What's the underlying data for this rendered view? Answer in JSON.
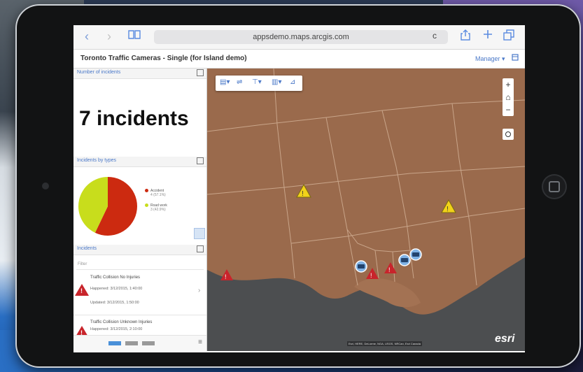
{
  "browser": {
    "url": "appsdemo.maps.arcgis.com",
    "back_glyph": "‹",
    "forward_glyph": "›",
    "reload_glyph": "c"
  },
  "app": {
    "title": "Toronto Traffic Cameras - Single (for Island demo)",
    "manager_label": "Manager ▾"
  },
  "panels": {
    "count": {
      "title": "Number of incidents",
      "value": "7 incidents"
    },
    "types": {
      "title": "Incidents by types",
      "pie": [
        {
          "label": "Accident",
          "sub": "4 (57.1%)",
          "fraction": 0.571,
          "color": "#cc2a10"
        },
        {
          "label": "Road work",
          "sub": "3 (42.9%)",
          "fraction": 0.429,
          "color": "#c8dd1c"
        }
      ]
    },
    "incidents": {
      "title": "Incidents",
      "filter_placeholder": "Filter",
      "items": [
        {
          "title": "Traffic Collision No Injuries",
          "happened": "Happened: 3/12/2015, 1:40:00",
          "updated": "Updated: 3/12/2015, 1:50:00"
        },
        {
          "title": "Traffic Collision Unknown Injuries",
          "happened": "Happened: 3/12/2015, 2:10:00",
          "updated": ""
        }
      ]
    }
  },
  "map": {
    "zoom_in": "+",
    "zoom_out": "−",
    "attribution": "Esri, HERE, DeLorme, NGA, USGS, NRCan, Esri Canada",
    "logo": "esri",
    "colors": {
      "land": "#9a6a4c",
      "water": "#4c4e50",
      "boundary": "#c9a58a"
    }
  },
  "colors": {
    "accent": "#4a78c8",
    "accident": "#c8242b",
    "roadwork": "#f1d21a"
  }
}
